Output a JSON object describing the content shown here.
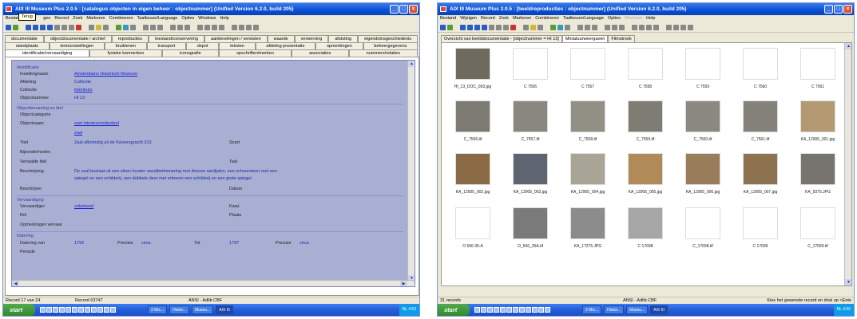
{
  "left": {
    "title": "AIX III Museum Plus 2.0.5 : [catalogus objecten in eigen beheer : objectnummer] (Unified Version 6.2.0, build 205)",
    "tooltip": "Terug",
    "menu": [
      "Bestand",
      "Terug",
      "gen",
      "Record",
      "Zoek",
      "Markeren",
      "Combineren",
      "Taalkeuze/Language",
      "Opties",
      "Windows",
      "Help"
    ],
    "tabs_row1": [
      "documentatie",
      "objectdocumentatie / archief",
      "reproducties",
      "toestand/conservering",
      "aanbevelingen / vereisten",
      "waarde",
      "verwerving",
      "afstoting",
      "eigendomsgeschiedenis"
    ],
    "tabs_row2": [
      "standplaats",
      "tentoonstellingen",
      "bruiklenen",
      "transport",
      "depot",
      "teksten",
      "afdeling presentatie",
      "opmerkingen",
      "beheergegevens"
    ],
    "tabs_row3": [
      "identificatie/vervaardiging",
      "fysieke kenmerken",
      "iconografie",
      "opschriften/merken",
      "associaties",
      "nummers/relaties"
    ],
    "form": {
      "sect_identificatie": "Identificatie",
      "lbl_instelling": "Instellingnaam",
      "val_instelling": "Amsterdams Historisch Museum",
      "lbl_afdeling": "Afdeling",
      "val_afdeling": "Collectie",
      "lbl_collectie": "Collectie",
      "val_collectie": "interieurs",
      "lbl_objectnummer": "Objectnummer",
      "val_objectnummer": "HI 13",
      "sect_benaming": "Objectbenaming en titel",
      "lbl_categorie": "Objectcategorie",
      "lbl_objectnaam": "Objectnaam",
      "val_objectnaam1": "vast interieuronderdeel",
      "val_objectnaam2": "zaal",
      "lbl_titel": "Titel",
      "val_titel": "Zaal afkomstig uit de Keizersgracht 313",
      "lbl_soort": "Soort",
      "lbl_bijzonderheden": "Bijzonderheden",
      "lbl_vertaalde": "Vertaalde titel",
      "lbl_taal": "Taal",
      "lbl_beschrijving": "Beschrijving",
      "val_beschrijving1": "De zaal bestaat uit een eiken houten wandbetimmering met diverse sierlijsten, een schoorsteen met een",
      "val_beschrijving2": "spiegel en een schilderij, een dubbele deur met erboven een schilderij en een grote spiegel.",
      "lbl_beschrijver": "Beschrijver",
      "lbl_datum": "Datum",
      "sect_vervaardiging": "Vervaardiging",
      "lbl_vervaardiger": "Vervaardiger",
      "val_vervaardiger": "onbekend",
      "lbl_kwal": "Kwal.",
      "lbl_rol": "Rol",
      "lbl_plaats": "Plaats",
      "lbl_opmerkingen": "Opmerkingen vervaar",
      "sect_datering": "Datering",
      "lbl_datering_van": "Datering van",
      "val_van": "1792",
      "lbl_precisie1": "Precisie",
      "val_precisie1": "circa",
      "lbl_tot": "Tot",
      "val_tot": "1797",
      "lbl_precisie2": "Precisie",
      "val_precisie2": "circa",
      "lbl_periode": "Periode"
    },
    "status": {
      "record": "Record 17 van 24",
      "record_id": "Record 63747",
      "encoding": "ANSI - Adlib CBF"
    }
  },
  "right": {
    "title": "AIX III Museum Plus 2.0.5 : [beeldreproducties : objectnummer] (Unified Version 6.2.0, build 205)",
    "menu": [
      "Bestand",
      "Wijzigen",
      "Record",
      "Zoek",
      "Markeren",
      "Combineren",
      "Taalkeuze/Language",
      "Opties",
      "Windows",
      "Help"
    ],
    "subtabs": [
      "Overzicht van beelddocumentatie - [objectnummer = HI 13]",
      "Miniatuurweergaven",
      "Filmstrook"
    ],
    "captions": [
      "HI_13_DOC_003.jpg",
      "C 7556",
      "C 7557",
      "C 7558",
      "C 7559",
      "C 7560",
      "C 7561",
      "C_7556.tif",
      "C_7557.tif",
      "C_7558.tif",
      "C_7559.tif",
      "C_7560.tif",
      "C_7561.tif",
      "KA_12905_001.jpg",
      "KA_12905_002.jpg",
      "KA_12905_003.jpg",
      "KA_12905_004.jpg",
      "KA_12905_005.jpg",
      "KA_12905_006.jpg",
      "KA_12905_007.jpg",
      "KA_9375.JPG",
      "O 566.35-A",
      "O_566_35A.tif",
      "KA_17275.JPG",
      "C 17698",
      "C_17698.tif",
      "C 17699",
      "C_17699.tif"
    ],
    "status": {
      "records": "31 records",
      "encoding": "ANSI - Adlib CBF",
      "hint": "Kies het gewenste record en druk op <Ente"
    }
  },
  "taskbar": {
    "start": "start",
    "tasks_left": [
      "2 Mic...",
      "Histor...",
      "Museu...",
      "AIX III"
    ],
    "tasks_right": [
      "2 Mic...",
      "Histor...",
      "Museu...",
      "AIX III"
    ],
    "clock_left": "4:53",
    "clock_right": "4:56",
    "tray_lang": "NL"
  }
}
